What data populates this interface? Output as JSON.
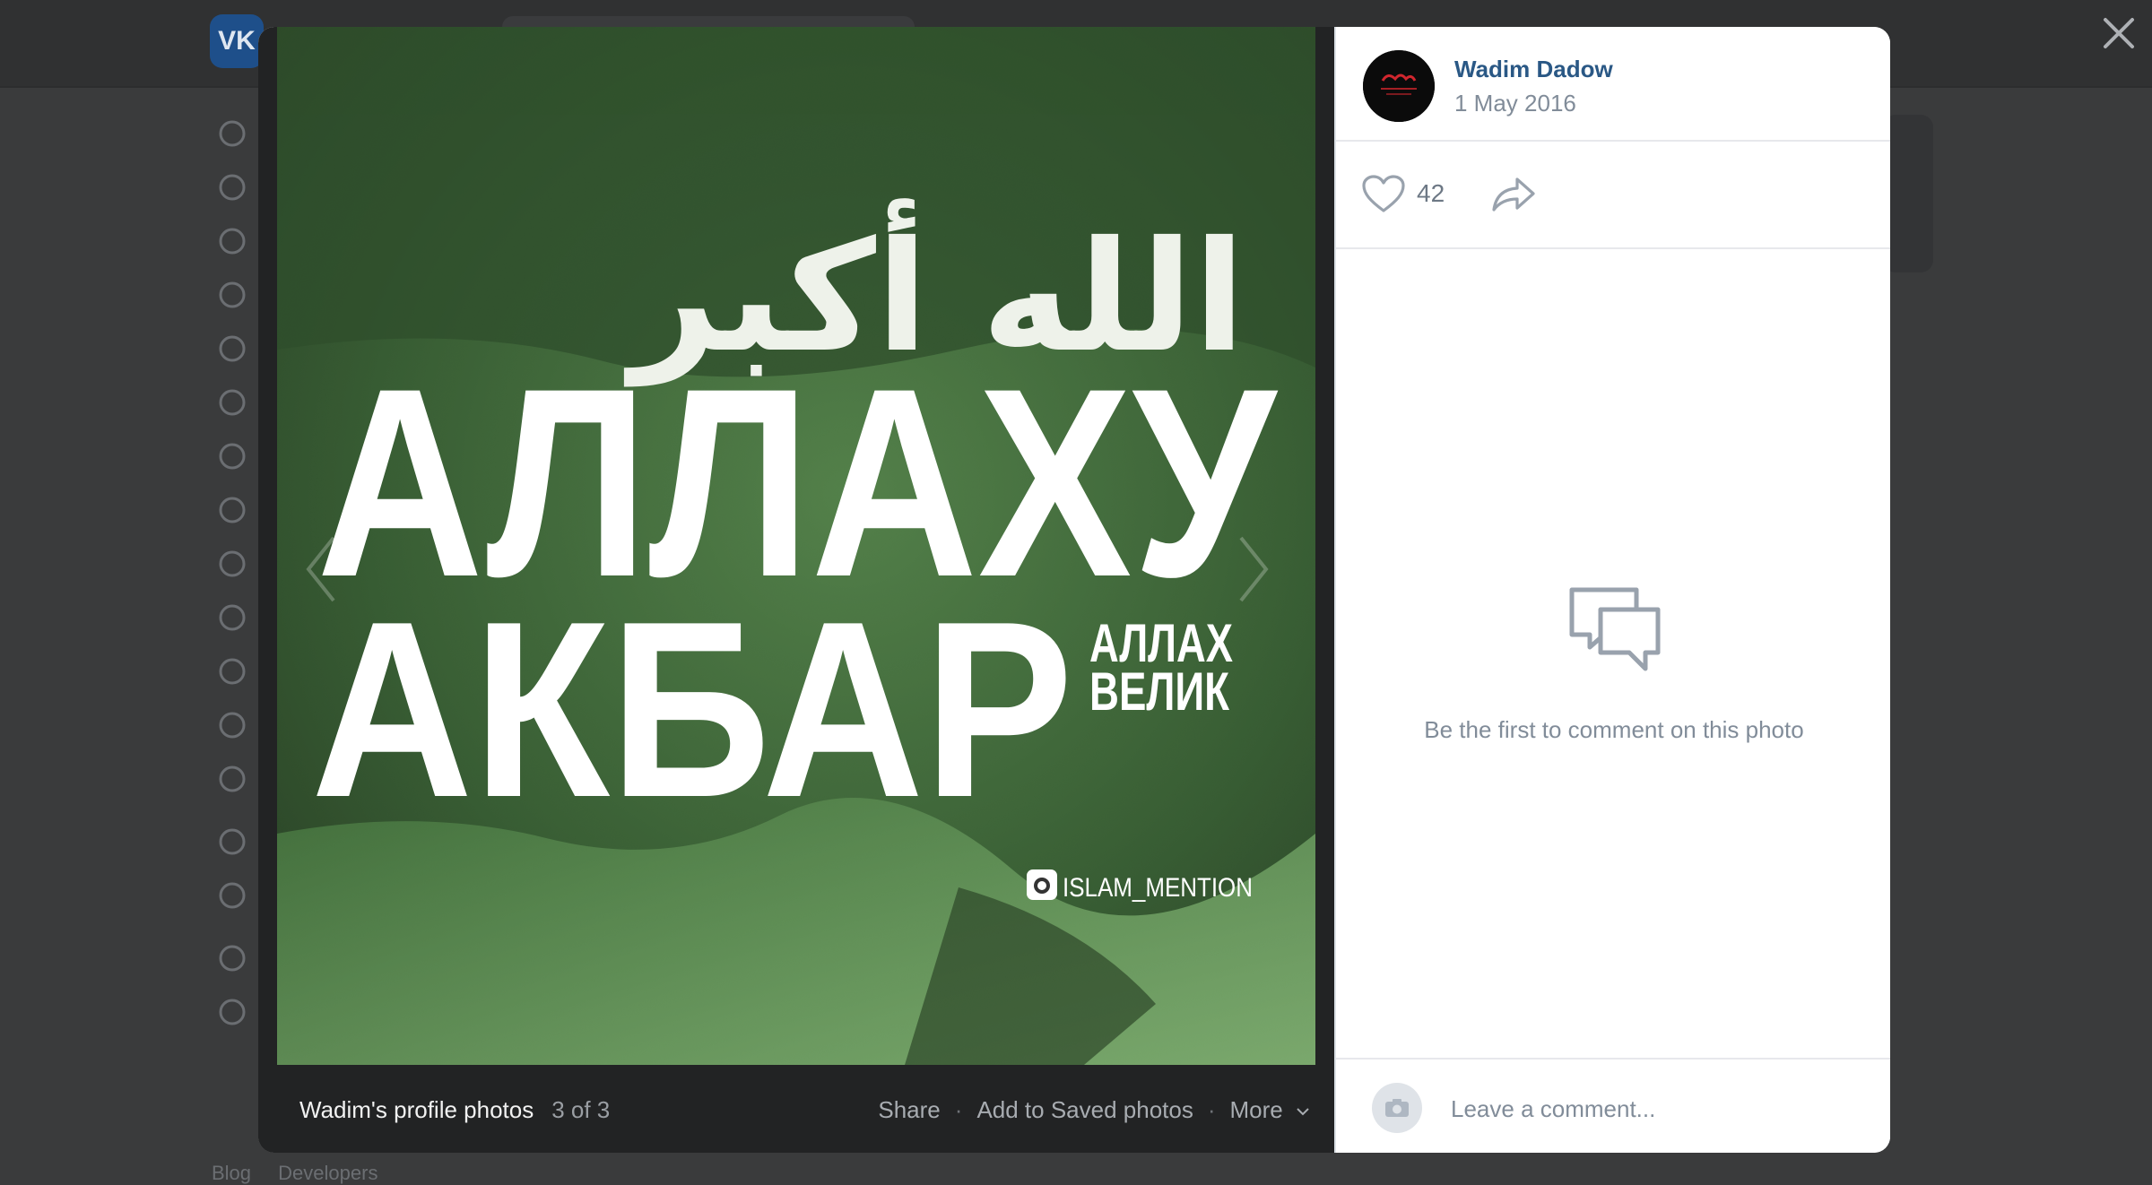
{
  "background": {
    "logo": "VK",
    "footer_links": [
      "Blog",
      "Developers"
    ],
    "sidebar_icons": [
      "profile-icon",
      "news-icon",
      "messages-icon",
      "calls-icon",
      "friends-icon",
      "communities-icon",
      "photos-icon",
      "music-icon",
      "video-icon",
      "clips-icon",
      "games-icon",
      "stickers-icon",
      "market-icon",
      "apps-icon",
      "pay-icon",
      "bookmarks-icon",
      "ads-icon"
    ]
  },
  "viewer": {
    "photo": {
      "headline_line1": "АЛЛАХУ",
      "headline_line2": "АКБАР",
      "subtitle_line1": "АЛЛАХ",
      "subtitle_line2": "ВЕЛИК",
      "watermark": "ISLAM_MENTION",
      "calligraphy": "الله أكبر"
    },
    "footer": {
      "album_title": "Wadim's profile photos",
      "counter": "3 of 3",
      "share_label": "Share",
      "save_label": "Add to Saved photos",
      "more_label": "More"
    },
    "author": {
      "name": "Wadim Dadow",
      "date": "1 May 2016"
    },
    "likes": "42",
    "comments": {
      "empty_text": "Be the first to comment on this photo",
      "placeholder": "Leave a comment..."
    }
  }
}
